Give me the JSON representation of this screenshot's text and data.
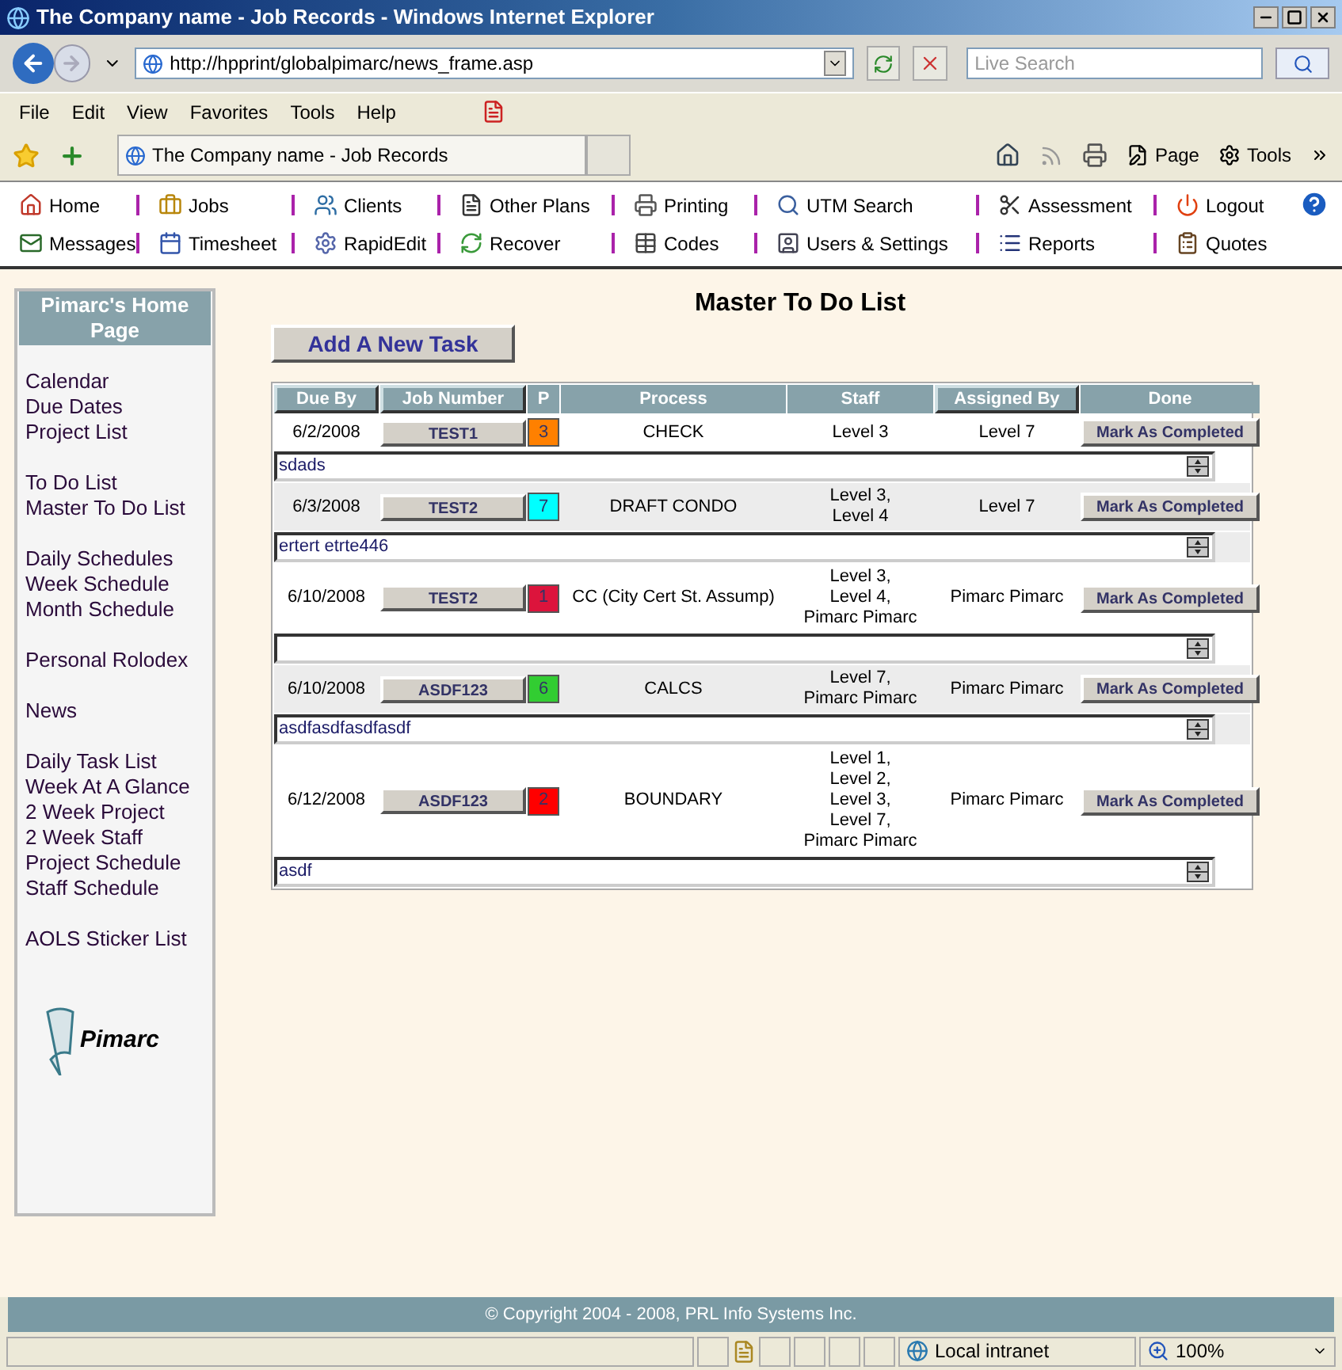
{
  "window": {
    "title": "The Company name - Job Records - Windows Internet Explorer"
  },
  "address_bar": {
    "url": "http://hpprint/globalpimarc/news_frame.asp"
  },
  "search": {
    "placeholder": "Live Search"
  },
  "menu": [
    "File",
    "Edit",
    "View",
    "Favorites",
    "Tools",
    "Help"
  ],
  "tab": {
    "title": "The Company name - Job Records"
  },
  "command_bar": [
    "Page",
    "Tools"
  ],
  "nav": [
    "Home",
    "Jobs",
    "Clients",
    "Other Plans",
    "Printing",
    "UTM Search",
    "Assessment",
    "Logout",
    "Messages",
    "Timesheet",
    "RapidEdit",
    "Recover",
    "Codes",
    "Users & Settings",
    "Reports",
    "Quotes"
  ],
  "sidebar": {
    "title": "Pimarc's Home Page",
    "groups": [
      [
        "Calendar",
        "Due Dates",
        "Project List"
      ],
      [
        "To Do List",
        "Master To Do List"
      ],
      [
        "Daily Schedules",
        "Week Schedule",
        "Month Schedule"
      ],
      [
        "Personal Rolodex"
      ],
      [
        "News"
      ],
      [
        "Daily Task List",
        "Week At A Glance",
        "2 Week Project",
        "2 Week Staff",
        "Project Schedule",
        "Staff Schedule"
      ],
      [
        "AOLS Sticker List"
      ]
    ],
    "logo_text": "Pimarc"
  },
  "page_title": "Master To Do List",
  "add_button": "Add A New Task",
  "table": {
    "columns": [
      {
        "label": "Due By",
        "sortable": true
      },
      {
        "label": "Job Number",
        "sortable": true
      },
      {
        "label": "P",
        "sortable": false
      },
      {
        "label": "Process",
        "sortable": false
      },
      {
        "label": "Staff",
        "sortable": false
      },
      {
        "label": "Assigned By",
        "sortable": true
      },
      {
        "label": "Done",
        "sortable": false
      }
    ],
    "rows": [
      {
        "due": "6/2/2008",
        "job": "TEST1",
        "priority": "3",
        "color": "#ff8000",
        "process": "CHECK",
        "staff": [
          "Level 3"
        ],
        "assigned_by": "Level 7",
        "action": "Mark As Completed",
        "note": "sdads",
        "shaded": false
      },
      {
        "due": "6/3/2008",
        "job": "TEST2",
        "priority": "7",
        "color": "#00ffff",
        "process": "DRAFT CONDO",
        "staff": [
          "Level 3,",
          "Level 4"
        ],
        "assigned_by": "Level 7",
        "action": "Mark As Completed",
        "note": "ertert etrte446",
        "shaded": true
      },
      {
        "due": "6/10/2008",
        "job": "TEST2",
        "priority": "1",
        "color": "#dc143c",
        "process": "CC (City Cert St. Assump)",
        "staff": [
          "Level 3,",
          "Level 4,",
          "Pimarc Pimarc"
        ],
        "assigned_by": "Pimarc Pimarc",
        "action": "Mark As Completed",
        "shaded": false
      },
      {
        "due": "6/10/2008",
        "job": "ASDF123",
        "priority": "6",
        "color": "#32cd32",
        "process": "CALCS",
        "staff": [
          "Level 7,",
          "Pimarc Pimarc"
        ],
        "assigned_by": "Pimarc Pimarc",
        "action": "Mark As Completed",
        "note": "asdfasdfasdfasdf",
        "shaded": true
      },
      {
        "due": "6/12/2008",
        "job": "ASDF123",
        "priority": "2",
        "color": "#ff0000",
        "process": "BOUNDARY",
        "staff": [
          "Level 1,",
          "Level 2,",
          "Level 3,",
          "Level 7,",
          "Pimarc Pimarc"
        ],
        "assigned_by": "Pimarc Pimarc",
        "action": "Mark As Completed",
        "note": "asdf",
        "shaded": false
      }
    ]
  },
  "footer": "© Copyright 2004 - 2008, PRL Info Systems Inc.",
  "status_bar": {
    "zone": "Local intranet",
    "zoom": "100%"
  }
}
